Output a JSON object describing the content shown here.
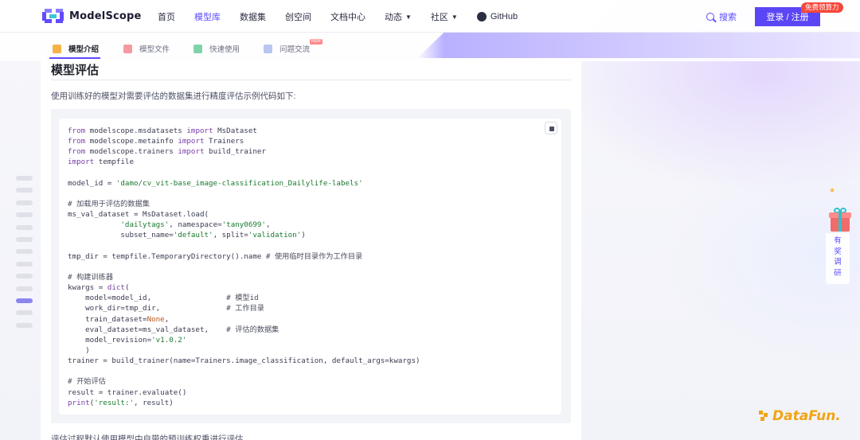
{
  "header": {
    "logo_text": "ModelScope",
    "nav": [
      {
        "label": "首页"
      },
      {
        "label": "模型库",
        "active": true
      },
      {
        "label": "数据集"
      },
      {
        "label": "创空间"
      },
      {
        "label": "文档中心"
      },
      {
        "label": "动态",
        "dropdown": true
      },
      {
        "label": "社区",
        "dropdown": true
      },
      {
        "label": "GitHub",
        "icon": "github-icon"
      }
    ],
    "search_label": "搜索",
    "login_label": "登录 / 注册",
    "promo_badge": "免费领算力",
    "accent_color": "#5b46f5"
  },
  "tabs": [
    {
      "label": "模型介绍",
      "icon": "cube-icon",
      "active": true
    },
    {
      "label": "模型文件",
      "icon": "file-icon"
    },
    {
      "label": "快速使用",
      "icon": "rocket-icon"
    },
    {
      "label": "问题交流",
      "icon": "chat-icon",
      "badge": "NEW"
    }
  ],
  "content": {
    "section_title": "模型评估",
    "intro": "使用训练好的模型对需要评估的数据集进行精度评估示例代码如下:",
    "bottom_text": "评估过程默认使用模型中自带的预训练权重进行评估"
  },
  "code_lines": [
    [
      {
        "t": "from",
        "c": "kw"
      },
      {
        "t": " modelscope.msdatasets "
      },
      {
        "t": "import",
        "c": "kw"
      },
      {
        "t": " MsDataset"
      }
    ],
    [
      {
        "t": "from",
        "c": "kw"
      },
      {
        "t": " modelscope.metainfo "
      },
      {
        "t": "import",
        "c": "kw"
      },
      {
        "t": " Trainers"
      }
    ],
    [
      {
        "t": "from",
        "c": "kw"
      },
      {
        "t": " modelscope.trainers "
      },
      {
        "t": "import",
        "c": "kw"
      },
      {
        "t": " build_trainer"
      }
    ],
    [
      {
        "t": "import",
        "c": "kw"
      },
      {
        "t": " tempfile"
      }
    ],
    [],
    [
      {
        "t": "model_id = "
      },
      {
        "t": "'damo/cv_vit-base_image-classification_Dailylife-labels'",
        "c": "str"
      }
    ],
    [],
    [
      {
        "t": "# 加载用于评估的数据集",
        "c": "cm"
      }
    ],
    [
      {
        "t": "ms_val_dataset = MsDataset.load("
      }
    ],
    [
      {
        "t": "            "
      },
      {
        "t": "'dailytags'",
        "c": "str"
      },
      {
        "t": ", namespace="
      },
      {
        "t": "'tany0699'",
        "c": "str"
      },
      {
        "t": ","
      }
    ],
    [
      {
        "t": "            subset_name="
      },
      {
        "t": "'default'",
        "c": "str"
      },
      {
        "t": ", split="
      },
      {
        "t": "'validation'",
        "c": "str"
      },
      {
        "t": ")"
      }
    ],
    [],
    [
      {
        "t": "tmp_dir = tempfile.TemporaryDirectory().name "
      },
      {
        "t": "# 使用临时目录作为工作目录",
        "c": "cm"
      }
    ],
    [],
    [
      {
        "t": "# 构建训练器",
        "c": "cm"
      }
    ],
    [
      {
        "t": "kwargs = "
      },
      {
        "t": "dict",
        "c": "kw"
      },
      {
        "t": "("
      }
    ],
    [
      {
        "t": "    model=model_id,                 "
      },
      {
        "t": "# 模型id",
        "c": "cm"
      }
    ],
    [
      {
        "t": "    work_dir=tmp_dir,               "
      },
      {
        "t": "# 工作目录",
        "c": "cm"
      }
    ],
    [
      {
        "t": "    train_dataset="
      },
      {
        "t": "None",
        "c": "num"
      },
      {
        "t": ","
      }
    ],
    [
      {
        "t": "    eval_dataset=ms_val_dataset,    "
      },
      {
        "t": "# 评估的数据集",
        "c": "cm"
      }
    ],
    [
      {
        "t": "    model_revision="
      },
      {
        "t": "'v1.0.2'",
        "c": "str"
      }
    ],
    [
      {
        "t": "    )"
      }
    ],
    [
      {
        "t": "trainer = build_trainer(name=Trainers.image_classification, default_args=kwargs)"
      }
    ],
    [],
    [
      {
        "t": "# 开始评估",
        "c": "cm"
      }
    ],
    [
      {
        "t": "result = trainer.evaluate()"
      }
    ],
    [
      {
        "t": "print",
        "c": "kw"
      },
      {
        "t": "("
      },
      {
        "t": "'result:'",
        "c": "str"
      },
      {
        "t": ", result)"
      }
    ]
  ],
  "outline_rail": {
    "count": 13,
    "active_index": 10
  },
  "survey_widget": {
    "label_chars": [
      "有",
      "奖",
      "调",
      "研"
    ]
  },
  "watermark": "DataFun."
}
